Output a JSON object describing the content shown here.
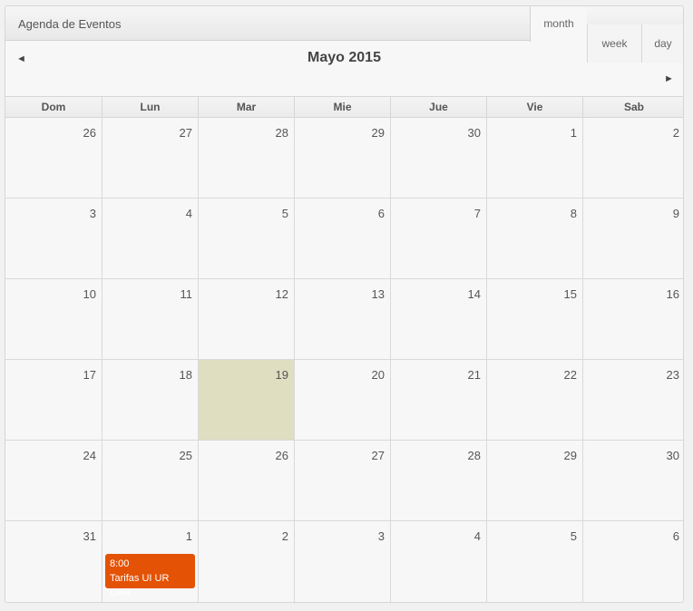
{
  "header": {
    "title": "Agenda de Eventos",
    "views": {
      "month": "month",
      "week": "week",
      "day": "day"
    },
    "nav": {
      "prev": "◄",
      "next": "►"
    },
    "month_title": "Mayo 2015"
  },
  "weekdays": [
    "Dom",
    "Lun",
    "Mar",
    "Mie",
    "Jue",
    "Vie",
    "Sab"
  ],
  "weeks": [
    [
      "26",
      "27",
      "28",
      "29",
      "30",
      "1",
      "2"
    ],
    [
      "3",
      "4",
      "5",
      "6",
      "7",
      "8",
      "9"
    ],
    [
      "10",
      "11",
      "12",
      "13",
      "14",
      "15",
      "16"
    ],
    [
      "17",
      "18",
      "19",
      "20",
      "21",
      "22",
      "23"
    ],
    [
      "24",
      "25",
      "26",
      "27",
      "28",
      "29",
      "30"
    ],
    [
      "31",
      "1",
      "2",
      "3",
      "4",
      "5",
      "6"
    ]
  ],
  "today": {
    "week": 3,
    "day": 2
  },
  "events": [
    {
      "week": 5,
      "day": 1,
      "time": "8:00",
      "title": "Tarifas UI UR UAR",
      "color": "#e35205"
    }
  ],
  "colors": {
    "today_bg": "#dfdec1",
    "event": "#e35205"
  }
}
